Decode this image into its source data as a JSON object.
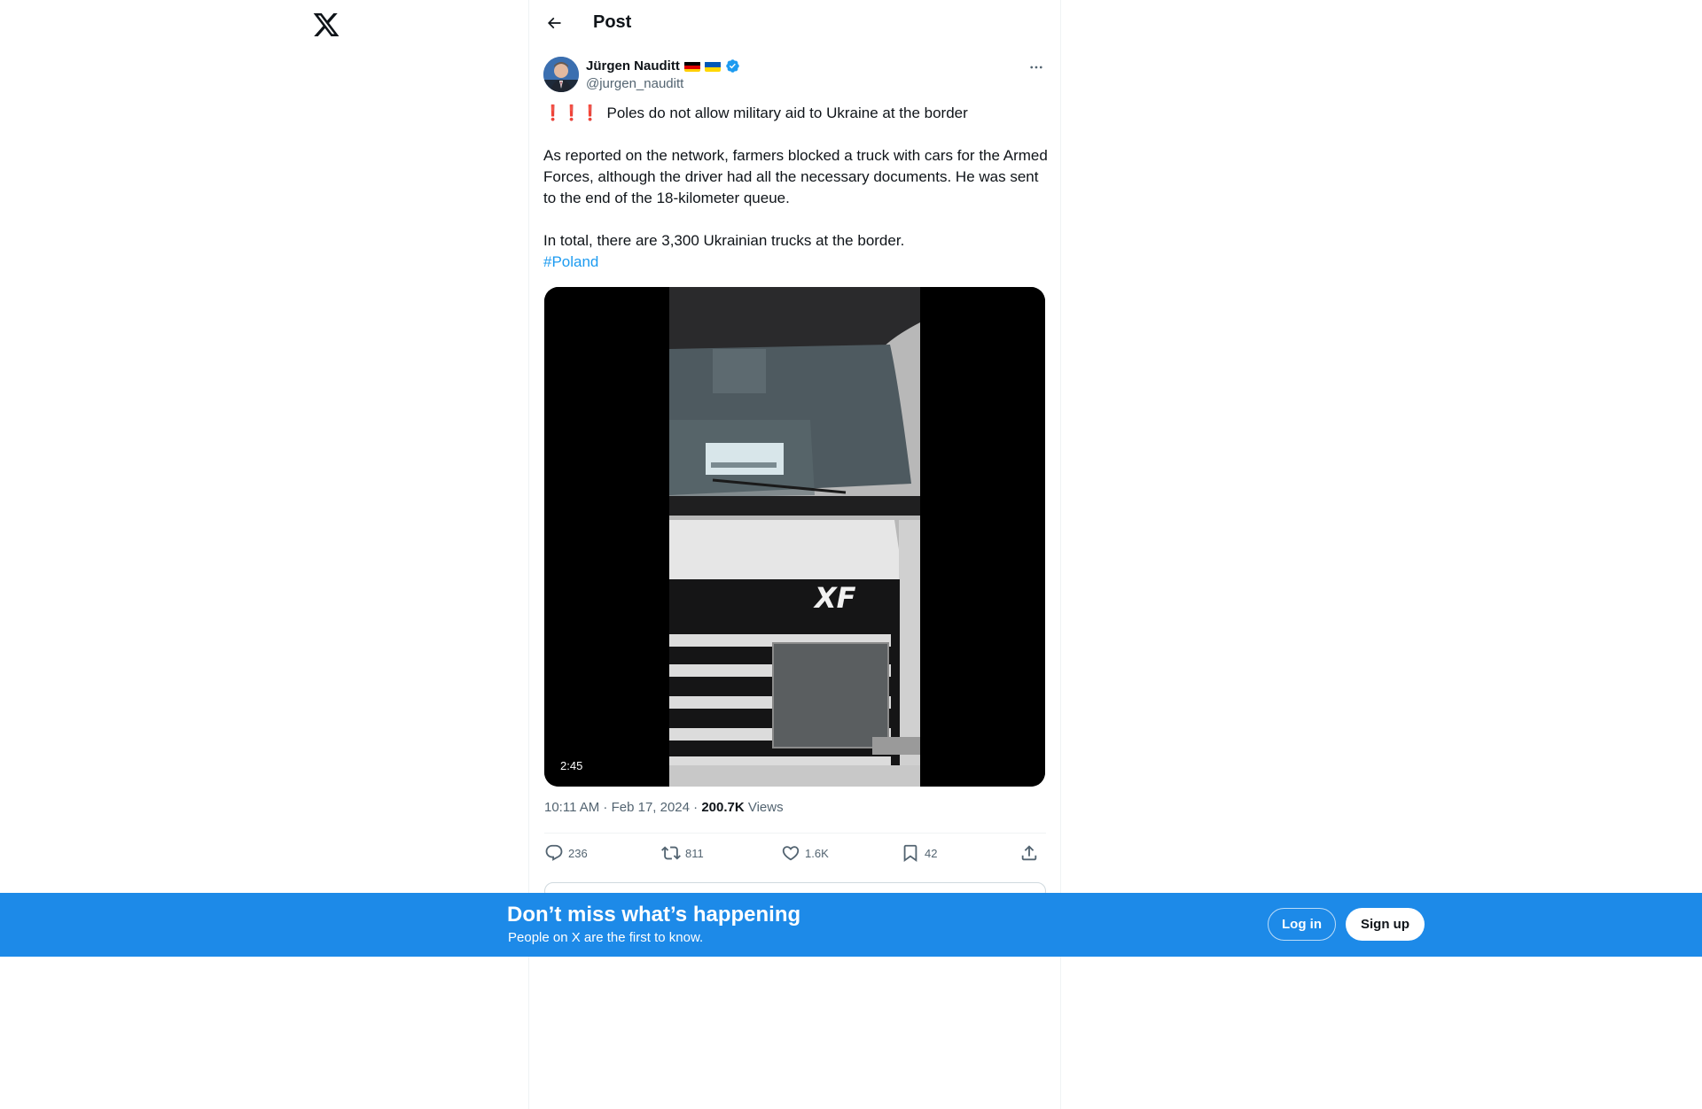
{
  "app": {
    "logo_icon": "x-logo-icon"
  },
  "header": {
    "title": "Post",
    "back_icon": "arrow-left-icon"
  },
  "post": {
    "author": {
      "name": "Jürgen Nauditt",
      "handle": "@jurgen_nauditt",
      "flags": [
        "germany-flag",
        "ukraine-flag"
      ],
      "verified": true
    },
    "text": {
      "line1": "Poles do not allow military aid to Ukraine at the border",
      "line1_prefix": "❗❗❗",
      "para2": "As reported on the network, farmers blocked a truck with cars for the Armed Forces, although the driver had all the necessary documents. He was sent to the end of the 18-kilometer queue.",
      "para3": "In total, there are 3,300 Ukrainian trucks at the border.",
      "hashtag": "#Poland"
    },
    "media": {
      "type": "video",
      "duration": "2:45",
      "truck_badge": "XF"
    },
    "meta": {
      "time_date": "10:11 AM · Feb 17, 2024 · ",
      "views_count": "200.7K",
      "views_label": " Views"
    },
    "stats": {
      "replies": "236",
      "reposts": "811",
      "likes": "1.6K",
      "bookmarks": "42"
    }
  },
  "banner": {
    "title": "Don’t miss what’s happening",
    "subtitle": "People on X are the first to know.",
    "login_label": "Log in",
    "signup_label": "Sign up"
  },
  "colors": {
    "accent": "#1d9bf0",
    "banner_bg": "#1d8ae8",
    "secondary_text": "#536471"
  }
}
